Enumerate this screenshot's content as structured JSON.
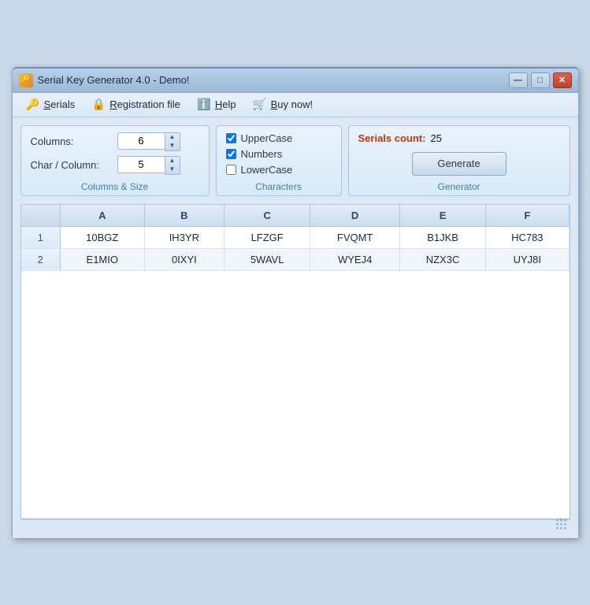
{
  "window": {
    "title": "Serial Key Generator 4.0 - Demo!",
    "icon": "🔑",
    "buttons": {
      "minimize": "—",
      "maximize": "□",
      "close": "✕"
    }
  },
  "menu": {
    "items": [
      {
        "id": "serials",
        "icon": "🔑",
        "label": "Serials",
        "underline_index": 0
      },
      {
        "id": "registration",
        "icon": "🔒",
        "label": "Registration file",
        "underline_index": 0
      },
      {
        "id": "help",
        "icon": "ℹ",
        "label": "Help",
        "underline_index": 0
      },
      {
        "id": "buy",
        "icon": "🛒",
        "label": "Buy now!",
        "underline_index": 0
      }
    ]
  },
  "columns_size": {
    "panel_label": "Columns & Size",
    "columns_label": "Columns:",
    "columns_value": "6",
    "char_column_label": "Char / Column:",
    "char_column_value": "5"
  },
  "characters": {
    "panel_label": "Characters",
    "options": [
      {
        "id": "uppercase",
        "label": "UpperCase",
        "checked": true
      },
      {
        "id": "numbers",
        "label": "Numbers",
        "checked": true
      },
      {
        "id": "lowercase",
        "label": "LowerCase",
        "checked": false
      }
    ]
  },
  "generator": {
    "panel_label": "Generator",
    "serials_count_label": "Serials count:",
    "serials_count_value": "25",
    "generate_btn": "Generate"
  },
  "table": {
    "columns": [
      "",
      "A",
      "B",
      "C",
      "D",
      "E",
      "F"
    ],
    "rows": [
      {
        "row_num": "1",
        "cols": [
          "10BGZ",
          "IH3YR",
          "LFZGF",
          "FVQMT",
          "B1JKB",
          "HC783"
        ]
      },
      {
        "row_num": "2",
        "cols": [
          "E1MIO",
          "0IXYI",
          "5WAVL",
          "WYEJ4",
          "NZX3C",
          "UYJ8I"
        ]
      }
    ]
  }
}
